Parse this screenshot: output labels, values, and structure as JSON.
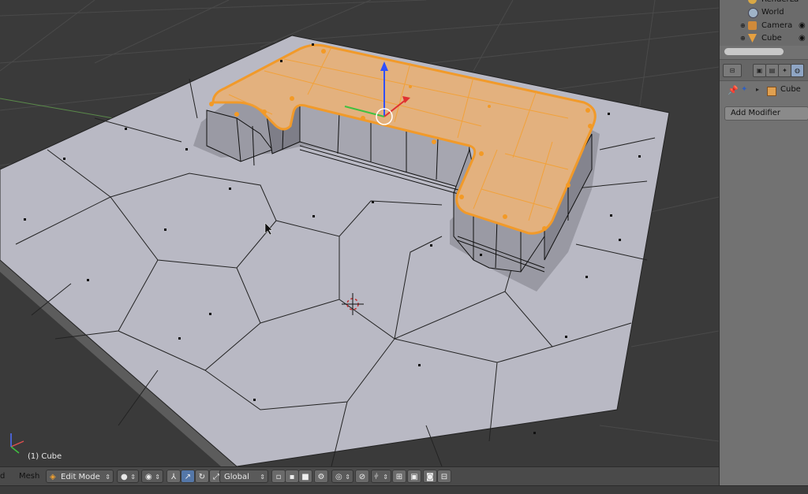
{
  "viewport": {
    "object_label": "(1) Cube"
  },
  "header": {
    "menu_view_partial": "d",
    "menu_mesh": "Mesh",
    "mode": "Edit Mode",
    "orientation": "Global"
  },
  "outliner": {
    "items": [
      {
        "label": "RenderLa",
        "icon": "render-layers-icon"
      },
      {
        "label": "World",
        "icon": "world-icon"
      },
      {
        "label": "Camera",
        "icon": "camera-icon"
      },
      {
        "label": "Cube",
        "icon": "mesh-icon"
      }
    ]
  },
  "properties": {
    "context_object": "Cube",
    "add_modifier_label": "Add Modifier"
  },
  "colors": {
    "viewport_bg": "#3a3a3a",
    "plane": "#b9b9c4",
    "selection": "#f0a030",
    "header_bg": "#4a4a4a",
    "panel_bg": "#727272"
  }
}
